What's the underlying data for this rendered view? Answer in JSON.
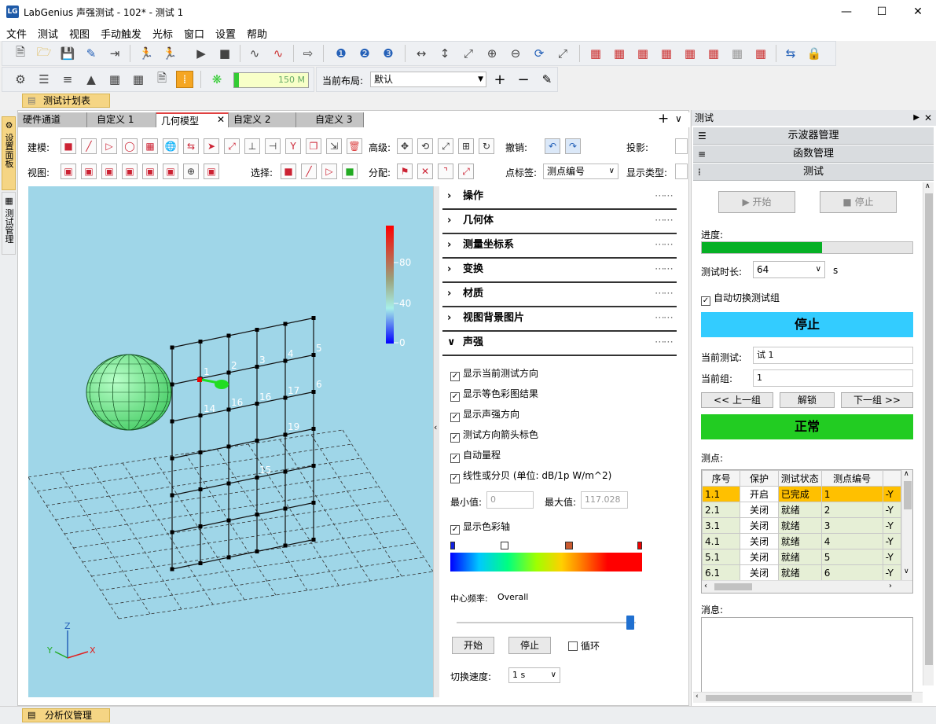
{
  "window": {
    "title": "LabGenius 声强测试 - 102* - 测试 1",
    "app_icon_text": "LG",
    "minimize_icon": "minimize-icon",
    "maximize_icon": "maximize-icon",
    "close_icon": "close-icon"
  },
  "menu": [
    "文件",
    "测试",
    "视图",
    "手动触发",
    "光标",
    "窗口",
    "设置",
    "帮助"
  ],
  "toolbar": {
    "memory_value": "150 M",
    "layout_label": "当前布局:",
    "layout_value": "默认"
  },
  "plan_tab": "测试计划表",
  "left_tabs": [
    "设置面板",
    "测试管理"
  ],
  "doc_tabs": [
    "硬件通道",
    "自定义 1",
    "几何模型",
    "自定义 2",
    "自定义 3"
  ],
  "model_toolbar": {
    "build_label": "建模:",
    "advanced_label": "高级:",
    "undo_label": "撤销:",
    "projection_label": "投影:",
    "view_label": "视图:",
    "select_label": "选择:",
    "assign_label": "分配:",
    "point_label_label": "点标签:",
    "point_label_value": "测点编号",
    "display_type_label": "显示类型:"
  },
  "viewport": {
    "colorbar_ticks": [
      "80",
      "40",
      "0"
    ],
    "point_labels": [
      "1",
      "2",
      "3",
      "4",
      "5",
      "6",
      "14",
      "16",
      "16",
      "17",
      "19",
      "15"
    ],
    "axes": {
      "x": "X",
      "y": "Y",
      "z": "Z"
    }
  },
  "sections": [
    "操作",
    "几何体",
    "测量坐标系",
    "变换",
    "材质",
    "视图背景图片",
    "声强"
  ],
  "sound_intensity": {
    "checks": [
      {
        "label": "显示当前测试方向",
        "checked": true
      },
      {
        "label": "显示等色彩图结果",
        "checked": true
      },
      {
        "label": "显示声强方向",
        "checked": true
      },
      {
        "label": "测试方向箭头标色",
        "checked": true
      },
      {
        "label": "自动量程",
        "checked": true
      },
      {
        "label": "线性或分贝 (单位: dB/1p W/m^2)",
        "checked": true
      }
    ],
    "min_label": "最小值:",
    "min_value": "0",
    "max_label": "最大值:",
    "max_value": "117.028",
    "show_colorbar_label": "显示色彩轴",
    "center_freq_label": "中心频率:",
    "center_freq_value": "Overall",
    "start_button": "开始",
    "stop_button": "停止",
    "loop_label": "循环",
    "switch_speed_label": "切换速度:",
    "switch_speed_value": "1 s"
  },
  "right_panel": {
    "header": "测试",
    "sections": [
      "示波器管理",
      "函数管理",
      "测试"
    ],
    "start_button": "开始",
    "stop_button": "停止",
    "progress_label": "进度:",
    "progress": 0.57,
    "duration_label": "测试时长:",
    "duration_value": "64",
    "duration_unit": "s",
    "auto_switch_label": "自动切换测试组",
    "big_stop_label": "停止",
    "big_stop_color": "#33ccff",
    "current_test_label": "当前测试:",
    "current_test_value": "试 1",
    "current_group_label": "当前组:",
    "current_group_value": "1",
    "prev_group": "<< 上一组",
    "unlock": "解锁",
    "next_group": "下一组 >>",
    "status_label": "正常",
    "status_color": "#22cc22",
    "points_label": "测点:",
    "table_headers": [
      "序号",
      "保护",
      "测试状态",
      "测点编号",
      ""
    ],
    "rows": [
      [
        "1.1",
        "开启",
        "已完成",
        "1",
        "-Y"
      ],
      [
        "2.1",
        "关闭",
        "就绪",
        "2",
        "-Y"
      ],
      [
        "3.1",
        "关闭",
        "就绪",
        "3",
        "-Y"
      ],
      [
        "4.1",
        "关闭",
        "就绪",
        "4",
        "-Y"
      ],
      [
        "5.1",
        "关闭",
        "就绪",
        "5",
        "-Y"
      ],
      [
        "6.1",
        "关闭",
        "就绪",
        "6",
        "-Y"
      ]
    ],
    "messages_label": "消息:"
  },
  "status_tab": "分析仪管理"
}
